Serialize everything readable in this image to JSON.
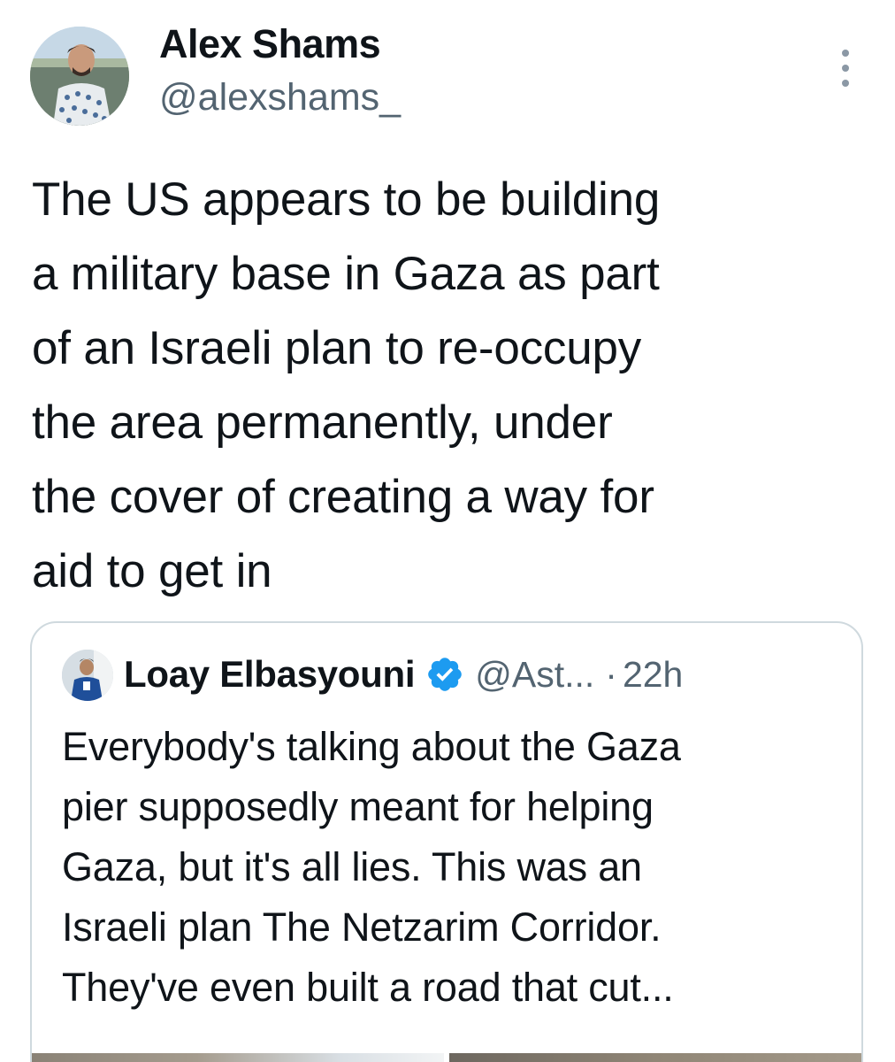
{
  "tweet": {
    "author": {
      "display_name": "Alex Shams",
      "handle": "@alexshams_",
      "avatar_icon": "profile-photo"
    },
    "more_icon": "more-vertical-icon",
    "text": "The US appears to be building\na military base in Gaza as part\nof an Israeli plan to re-occupy\nthe area permanently, under\nthe cover of creating a way for\naid to get in"
  },
  "quoted_tweet": {
    "author": {
      "display_name": "Loay Elbasyouni",
      "handle": "@Ast...",
      "verified": true,
      "avatar_icon": "profile-photo"
    },
    "separator": "·",
    "time": "22h",
    "text": "Everybody's talking about the Gaza\npier supposedly meant for helping\nGaza, but it's all lies. This was an\nIsraeli plan The Netzarim Corridor.\nThey've even built a road that cut...",
    "verified_color": "#1d9bf0"
  },
  "colors": {
    "primary_text": "#0f1419",
    "secondary_text": "#536471",
    "border": "#cfd9de",
    "verified_badge": "#1d9bf0"
  }
}
